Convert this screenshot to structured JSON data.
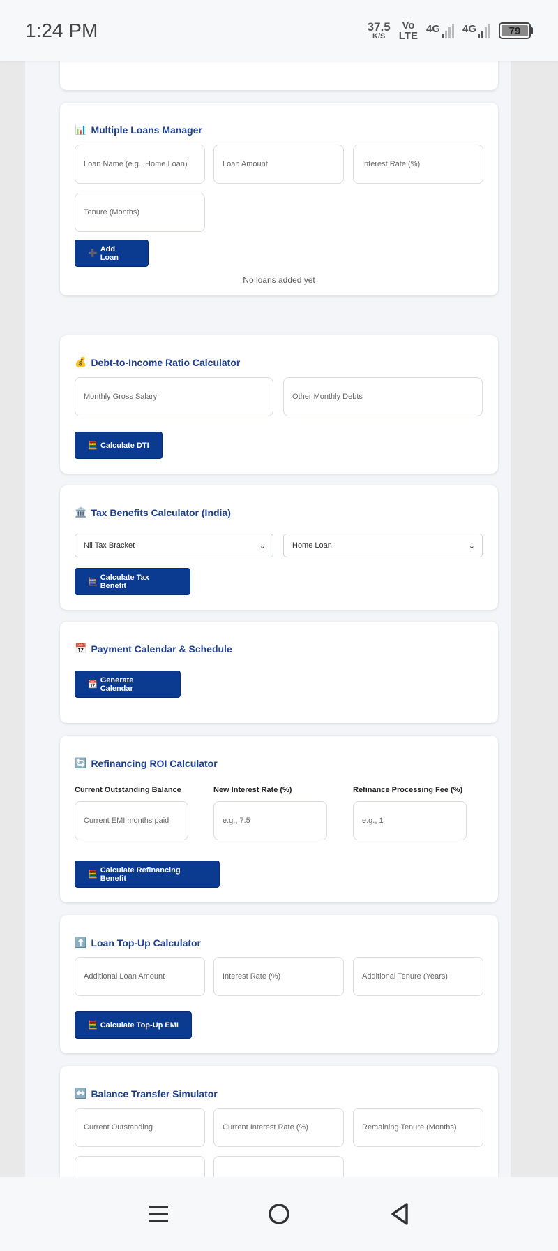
{
  "status": {
    "time": "1:24 PM",
    "speed_value": "37.5",
    "speed_unit": "K/S",
    "volte_top": "Vo",
    "volte_bottom": "LTE",
    "net1": "4G",
    "net2": "4G",
    "battery": "79"
  },
  "multi_loans": {
    "icon": "📊",
    "title": "Multiple Loans Manager",
    "name_placeholder": "Loan Name (e.g., Home Loan)",
    "amount_placeholder": "Loan Amount",
    "rate_placeholder": "Interest Rate (%)",
    "tenure_placeholder": "Tenure (Months)",
    "add_icon": "➕",
    "add_label": "Add Loan",
    "empty_text": "No loans added yet"
  },
  "dti": {
    "icon": "💰",
    "title": "Debt-to-Income Ratio Calculator",
    "salary_placeholder": "Monthly Gross Salary",
    "debts_placeholder": "Other Monthly Debts",
    "btn_icon": "🧮",
    "btn_label": "Calculate DTI"
  },
  "tax": {
    "icon": "🏛️",
    "title": "Tax Benefits Calculator (India)",
    "bracket_selected": "Nil Tax Bracket",
    "loan_type_selected": "Home Loan",
    "btn_icon": "🧮",
    "btn_label": "Calculate Tax Benefit"
  },
  "calendar": {
    "icon": "📅",
    "title": "Payment Calendar & Schedule",
    "btn_icon": "📆",
    "btn_label": "Generate Calendar"
  },
  "refinance": {
    "icon": "🔄",
    "title": "Refinancing ROI Calculator",
    "label1": "Current Outstanding Balance",
    "label2": "New Interest Rate (%)",
    "label3": "Refinance Processing Fee (%)",
    "field1_placeholder": "Current EMI months paid",
    "field2_placeholder": "e.g., 7.5",
    "field3_placeholder": "e.g., 1",
    "btn_icon": "🧮",
    "btn_label": "Calculate Refinancing Benefit"
  },
  "topup": {
    "icon": "⬆️",
    "title": "Loan Top-Up Calculator",
    "amount_placeholder": "Additional Loan Amount",
    "rate_placeholder": "Interest Rate (%)",
    "tenure_placeholder": "Additional Tenure (Years)",
    "btn_icon": "🧮",
    "btn_label": "Calculate Top-Up EMI"
  },
  "transfer": {
    "icon": "↔️",
    "title": "Balance Transfer Simulator",
    "outstanding_placeholder": "Current Outstanding",
    "rate_placeholder": "Current Interest Rate (%)",
    "tenure_placeholder": "Remaining Tenure (Months)"
  }
}
